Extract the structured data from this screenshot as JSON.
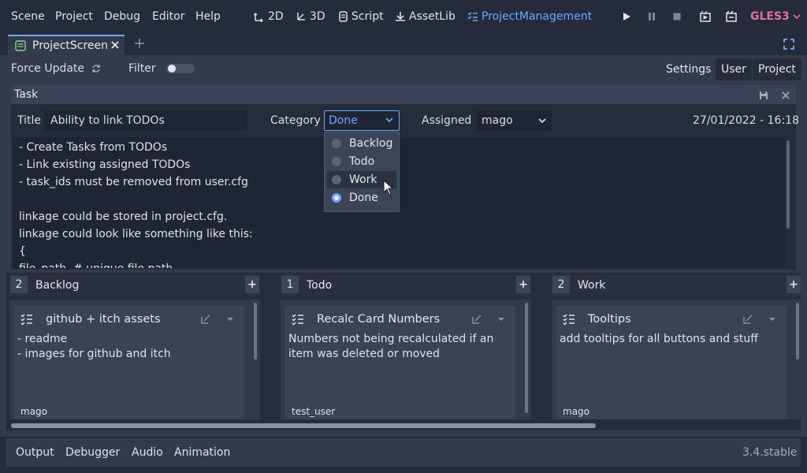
{
  "menubar": {
    "items": [
      "Scene",
      "Project",
      "Debug",
      "Editor",
      "Help"
    ],
    "workspaces": [
      "2D",
      "3D",
      "Script",
      "AssetLib",
      "ProjectManagement"
    ],
    "renderer": "GLES3"
  },
  "tabs": [
    {
      "label": "ProjectScreen"
    }
  ],
  "toolbar": {
    "force_update": "Force Update",
    "filter": "Filter",
    "settings": "Settings",
    "user": "User",
    "project": "Project"
  },
  "task": {
    "panel_title": "Task",
    "title_label": "Title",
    "title_value": "Ability to link TODOs",
    "category_label": "Category",
    "category_value": "Done",
    "assigned_label": "Assigned",
    "assigned_value": "mago",
    "date": "27/01/2022 - 16:18",
    "description_lines": [
      "- Create Tasks from TODOs",
      "- Link existing assigned TODOs",
      "- task_ids must be removed from user.cfg",
      "",
      "linkage could be stored in project.cfg.",
      "linkage could look like something like this:",
      "{",
      "file_path  # unique file path"
    ],
    "category_options": [
      "Backlog",
      "Todo",
      "Work",
      "Done"
    ],
    "selected_option": "Done",
    "hovered_option": "Work"
  },
  "columns": [
    {
      "count": "2",
      "title": "Backlog",
      "card": {
        "title": "github + itch assets",
        "lines": [
          "- readme",
          "- images for github and itch"
        ],
        "user": "mago"
      }
    },
    {
      "count": "1",
      "title": "Todo",
      "card": {
        "title": "Recalc Card Numbers",
        "lines": [
          "Numbers not being recalculated if an",
          "item was deleted or moved"
        ],
        "user": "test_user"
      }
    },
    {
      "count": "2",
      "title": "Work",
      "card": {
        "title": "Tooltips",
        "lines": [
          "add tooltips for all buttons and stuff"
        ],
        "user": "mago"
      }
    }
  ],
  "column_add_label": "+",
  "bottom_panel": {
    "items": [
      "Output",
      "Debugger",
      "Audio",
      "Animation"
    ],
    "version": "3.4.stable"
  },
  "colors": {
    "accent": "#6ea8ff",
    "renderer": "#e0739a",
    "background": "#252b3a",
    "panel": "#323a4c"
  },
  "icons": [
    "reload-icon",
    "save-icon",
    "close-icon",
    "edit-icon",
    "chevron-down-icon",
    "task-list-icon",
    "play-icon",
    "pause-icon",
    "stop-icon",
    "play-scene-icon",
    "play-custom-icon",
    "distraction-free-icon",
    "tab-add-icon",
    "mouse-cursor-icon"
  ]
}
